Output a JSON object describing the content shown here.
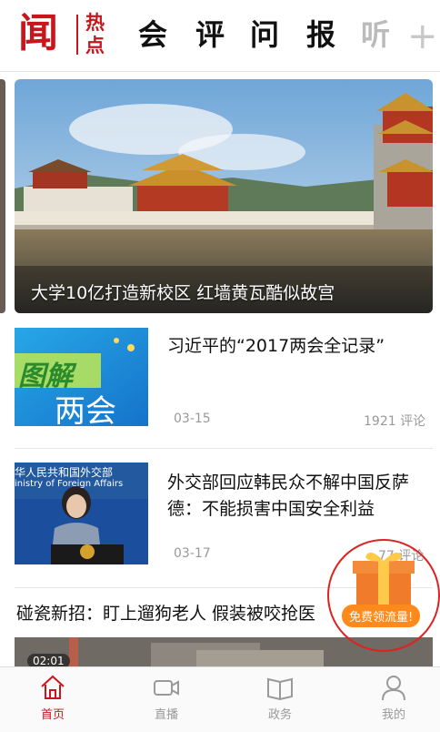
{
  "header": {
    "logo_main": "闻",
    "logo_sub": "热点",
    "tabs": [
      "会",
      "评",
      "问",
      "报",
      "听"
    ],
    "add_icon": "plus-icon"
  },
  "hero": {
    "caption": "大学10亿打造新校区 红墙黄瓦酷似故宫"
  },
  "news": [
    {
      "thumb_text_1": "图解",
      "thumb_text_2": "两会",
      "title": "习近平的“2017两会全记录”",
      "date": "03-15",
      "comments": "1921 评论"
    },
    {
      "thumb_text_1": "华人民共和国外交部",
      "thumb_text_2": "inistry of Foreign Affairs",
      "title": "外交部回应韩民众不解中国反萨德：不能损害中国安全利益",
      "date": "03-17",
      "comments": "77 评论"
    }
  ],
  "third_item": {
    "title": "碰瓷新招：盯上遛狗老人 假装被咬抢医",
    "video_duration": "02:01"
  },
  "promo": {
    "label": "免费领流量!"
  },
  "tabbar": [
    {
      "label": "首页",
      "icon": "home-icon",
      "active": true
    },
    {
      "label": "直播",
      "icon": "video-camera-icon",
      "active": false
    },
    {
      "label": "政务",
      "icon": "open-book-icon",
      "active": false
    },
    {
      "label": "我的",
      "icon": "user-icon",
      "active": false
    }
  ],
  "colors": {
    "brand_red": "#c8161d",
    "muted_gray": "#999999"
  }
}
